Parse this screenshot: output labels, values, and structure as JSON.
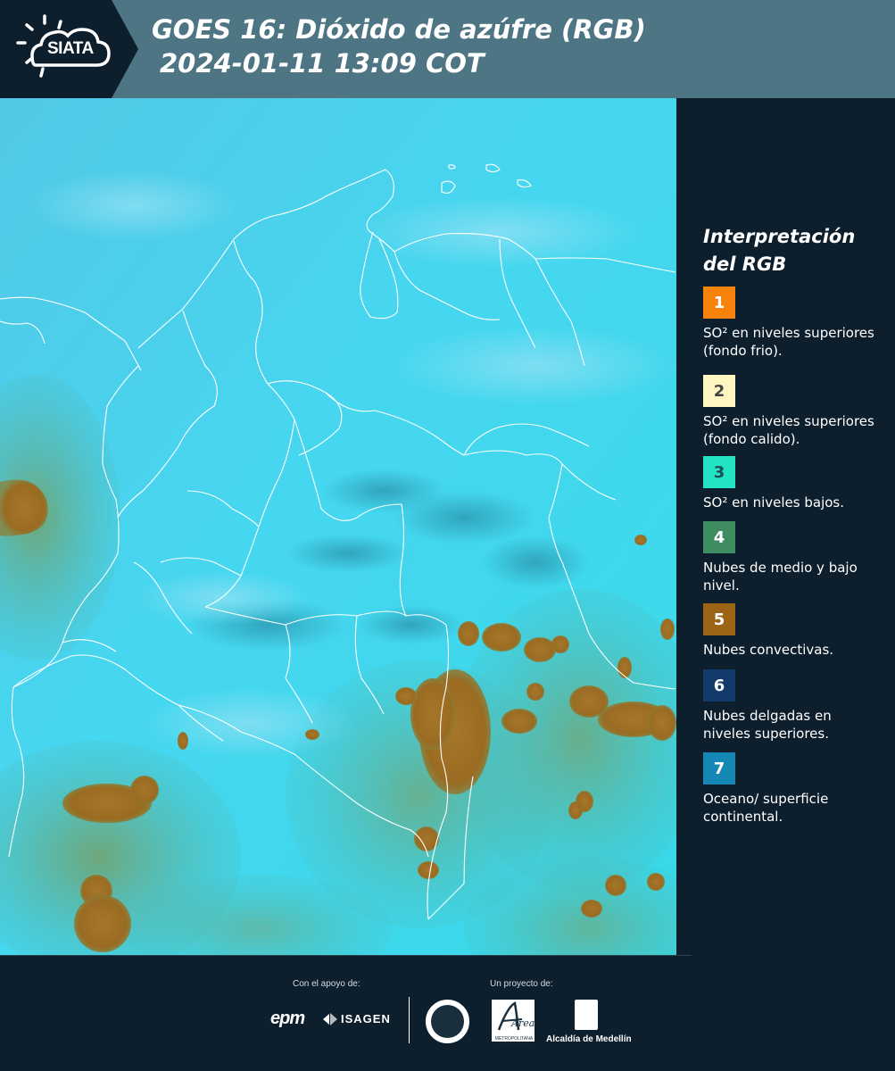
{
  "header": {
    "logo_text": "SIATA",
    "title_line1": "GOES 16: Dióxido de azúfre (RGB)",
    "title_line2": "2024-01-11 13:09 COT"
  },
  "legend": {
    "title": "Interpretación del RGB",
    "items": [
      {
        "number": "1",
        "color": "#f7820c",
        "text_color": "#ffffff",
        "description": "SO² en niveles superiores (fondo frio)."
      },
      {
        "number": "2",
        "color": "#fff6c2",
        "text_color": "#444444",
        "description": "SO² en niveles superiores (fondo calido)."
      },
      {
        "number": "3",
        "color": "#22e3c3",
        "text_color": "#1e4e54",
        "description": "SO² en niveles bajos."
      },
      {
        "number": "4",
        "color": "#3f8c62",
        "text_color": "#ffffff",
        "description": "Nubes de medio y bajo nivel."
      },
      {
        "number": "5",
        "color": "#9b6417",
        "text_color": "#ffffff",
        "description": "Nubes convectivas."
      },
      {
        "number": "6",
        "color": "#123a6a",
        "text_color": "#ffffff",
        "description": "Nubes delgadas en niveles superiores."
      },
      {
        "number": "7",
        "color": "#1688b5",
        "text_color": "#ffffff",
        "description": "Oceano/ superficie continental."
      }
    ]
  },
  "footer": {
    "support_label": "Con el apoyo de:",
    "project_label": "Un proyecto de:",
    "sponsor_1": "epm",
    "sponsor_2": "ISAGEN",
    "partner_area": "Área",
    "partner_area_sub": "METROPOLITANA Valle de Aburrá",
    "partner_alcaldia": "Alcaldía de Medellín"
  },
  "colors": {
    "header_bg": "#4d7583",
    "page_bg": "#0d1f2d",
    "logo_bg": "#0d1f2d",
    "ocean_cyan": "#3fd3ee",
    "convective_brown": "#9b6417",
    "border_white": "#ffffff"
  }
}
